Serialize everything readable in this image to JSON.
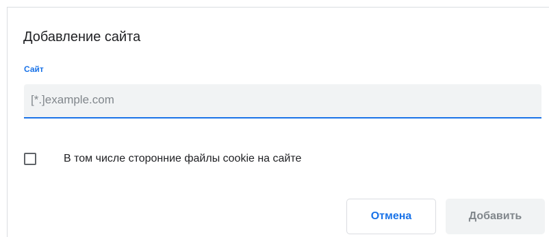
{
  "dialog": {
    "title": "Добавление сайта",
    "site_field": {
      "label": "Сайт",
      "placeholder": "[*.]example.com",
      "value": ""
    },
    "third_party_checkbox": {
      "label": "В том числе сторонние файлы cookie на сайте",
      "checked": false
    },
    "buttons": {
      "cancel": "Отмена",
      "add": "Добавить"
    }
  },
  "colors": {
    "accent": "#1a73e8",
    "input_background": "#f1f3f4",
    "disabled_text": "#80868b",
    "text": "#202124"
  }
}
